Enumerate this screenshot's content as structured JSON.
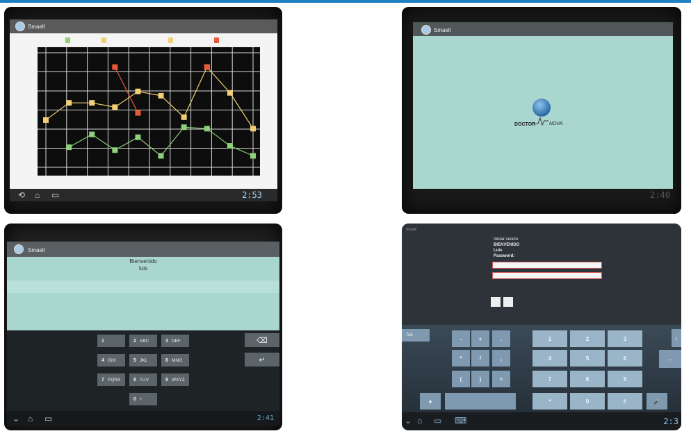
{
  "colors": {
    "accent_line": "#1f7fc2",
    "teal_screen": "#a9d6cf",
    "keyboard_blue": "#7e99b0"
  },
  "chart_screen": {
    "app_title": "Smaell",
    "clock": "2:53",
    "chart_data": {
      "type": "line",
      "title": "",
      "xlabel": "",
      "ylabel": "",
      "grid": true,
      "legend_placement": "top",
      "x": [
        1,
        2,
        3,
        4,
        5,
        6,
        7,
        8,
        9,
        10
      ],
      "series": [
        {
          "color": "#f2cf74",
          "values": [
            3.3,
            4.5,
            4.5,
            4.2,
            5.3,
            5.0,
            3.5,
            7.0,
            5.2,
            2.7
          ]
        },
        {
          "color": "#e8593a",
          "values": [
            null,
            null,
            null,
            7.0,
            3.8,
            null,
            null,
            7.0,
            null,
            null
          ]
        },
        {
          "color": "#8fd07a",
          "values": [
            null,
            1.4,
            2.3,
            1.2,
            2.1,
            0.8,
            2.8,
            2.7,
            1.5,
            0.8
          ]
        }
      ],
      "ylim": [
        0,
        8
      ]
    }
  },
  "splash_screen": {
    "app_title": "Smaell",
    "logo_text_left": "DOCTOR",
    "logo_text_right": "NOVA",
    "clock": "2:40"
  },
  "pin_screen": {
    "app_title": "Smaell",
    "welcome_line1": "Bienvenido",
    "welcome_line2": "luis",
    "clock": "2:41",
    "keys": [
      {
        "n": "1",
        "l": ""
      },
      {
        "n": "2",
        "l": "ABC"
      },
      {
        "n": "3",
        "l": "DEF"
      },
      {
        "n": "4",
        "l": "GHI"
      },
      {
        "n": "5",
        "l": "JKL"
      },
      {
        "n": "6",
        "l": "MNO"
      },
      {
        "n": "7",
        "l": "PQRS"
      },
      {
        "n": "8",
        "l": "TUV"
      },
      {
        "n": "9",
        "l": "WXYZ"
      },
      {
        "n": "0",
        "l": "+"
      }
    ],
    "backspace_label": "⌫",
    "enter_label": "↵"
  },
  "login_screen": {
    "status_text": "Smaell",
    "header": "Iniciar sesión",
    "line1": "BIENVENIDO",
    "line2": "Luis",
    "line3": "Password:",
    "tab_label": "Tab",
    "sym_keys": [
      "-",
      "+",
      ".",
      "*",
      "/",
      ",",
      "(",
      ")",
      "="
    ],
    "num_keys": [
      "1",
      "2",
      "3",
      "4",
      "5",
      "6",
      "7",
      "8",
      "9",
      "*",
      "0",
      "#"
    ],
    "clock": "2:3"
  }
}
